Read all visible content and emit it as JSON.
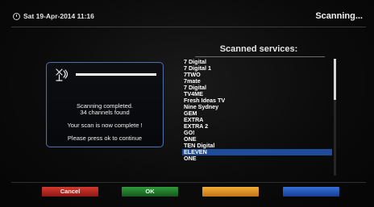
{
  "header": {
    "datetime": "Sat 19-Apr-2014  11:16",
    "status": "Scanning..."
  },
  "dialog": {
    "progress_fraction": 1.0,
    "line1": "Scanning completed.",
    "line2": "34 channels found",
    "line3": "Your scan is now complete !",
    "line4": "Please press ok to continue"
  },
  "services": {
    "title": "Scanned services:",
    "items": [
      "7 Digital",
      "7 Digital 1",
      "7TWO",
      "7mate",
      "7 Digital",
      "TV4ME",
      "Fresh Ideas TV",
      "Nine Sydney",
      "GEM",
      "EXTRA",
      "EXTRA 2",
      "GO!",
      "ONE",
      "TEN Digital",
      "ELEVEN",
      "ONE"
    ],
    "selected_index": 14,
    "scroll_fraction": 0.35
  },
  "buttons": {
    "red": "Cancel",
    "green": "OK",
    "yellow": "",
    "blue": ""
  },
  "colors": {
    "red": "#c62a22",
    "green": "#237a2c",
    "yellow": "#f0a02c",
    "blue": "#2a5bc4",
    "selection": "#1f4c9a"
  }
}
